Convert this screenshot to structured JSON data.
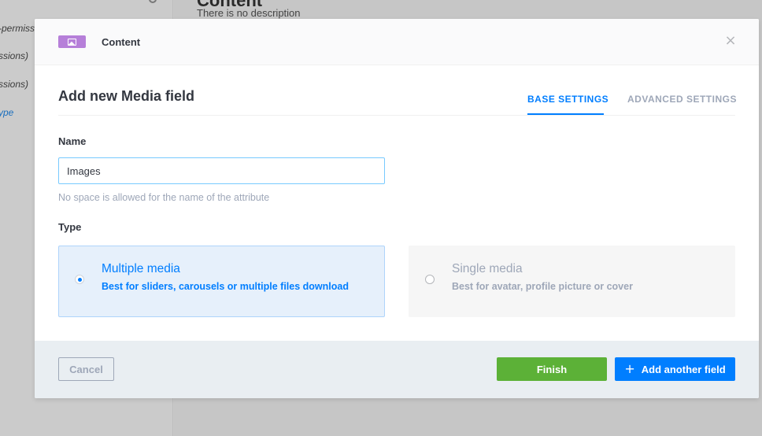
{
  "background": {
    "sidebar_items": [
      "-permiss",
      "ssions)",
      "ssions)",
      "ype"
    ],
    "content_title": "Content",
    "content_description": "There is no description"
  },
  "modal": {
    "header": {
      "icon": "image-icon",
      "icon_color": "#b67fd9",
      "title": "Content",
      "close_icon": "close-icon"
    },
    "form_title": "Add new Media field",
    "tabs": [
      {
        "label": "BASE SETTINGS",
        "active": true
      },
      {
        "label": "ADVANCED SETTINGS",
        "active": false
      }
    ],
    "name": {
      "label": "Name",
      "value": "Images",
      "hint": "No space is allowed for the name of the attribute"
    },
    "type": {
      "label": "Type",
      "options": [
        {
          "title": "Multiple media",
          "description": "Best for sliders, carousels or multiple files download",
          "selected": true
        },
        {
          "title": "Single media",
          "description": "Best for avatar, profile picture or cover",
          "selected": false
        }
      ]
    },
    "footer": {
      "cancel_label": "Cancel",
      "finish_label": "Finish",
      "add_another_label": "Add another field",
      "add_icon": "plus-icon"
    }
  },
  "colors": {
    "primary": "#007eff",
    "success": "#5cb137",
    "muted": "#9ea7b8"
  }
}
